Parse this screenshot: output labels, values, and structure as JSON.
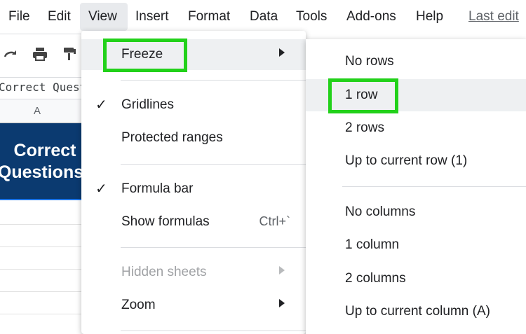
{
  "menubar": {
    "file": "File",
    "edit": "Edit",
    "view": "View",
    "insert": "Insert",
    "format": "Format",
    "data": "Data",
    "tools": "Tools",
    "addons": "Add-ons",
    "help": "Help",
    "last_edit": "Last edit"
  },
  "formula_bar": {
    "text": "Correct Questions"
  },
  "sheet": {
    "column_header": "A",
    "cell_line1": "Correct",
    "cell_line2": "Questions"
  },
  "view_menu": {
    "freeze": "Freeze",
    "gridlines": "Gridlines",
    "protected_ranges": "Protected ranges",
    "formula_bar": "Formula bar",
    "show_formulas": "Show formulas",
    "show_formulas_shortcut": "Ctrl+`",
    "hidden_sheets": "Hidden sheets",
    "zoom": "Zoom",
    "checkmark": "✓"
  },
  "freeze_submenu": {
    "no_rows": "No rows",
    "one_row": "1 row",
    "two_rows": "2 rows",
    "up_to_current_row": "Up to current row (1)",
    "no_columns": "No columns",
    "one_column": "1 column",
    "two_columns": "2 columns",
    "up_to_current_column": "Up to current column (A)"
  },
  "colors": {
    "highlight": "#22d11a",
    "header_fill": "#0b3a70",
    "hover": "#eef0f2"
  },
  "icons": [
    "redo-icon",
    "print-icon",
    "paint-format-icon",
    "chevron-right-icon",
    "checkmark-icon"
  ]
}
